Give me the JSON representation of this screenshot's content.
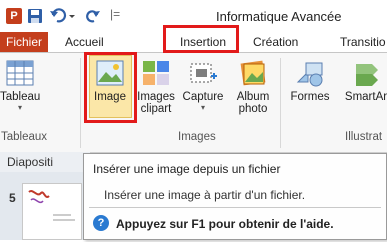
{
  "title": "Informatique Avancée",
  "quick_access": {
    "app_icon": "P",
    "separator": "|="
  },
  "tabs": {
    "file": "Fichier",
    "accueil": "Accueil",
    "insertion": "Insertion",
    "creation": "Création",
    "transitions": "Transitio"
  },
  "ribbon": {
    "tableau": "Tableau",
    "image": "Image",
    "images_line1": "Images",
    "images_line2": "clipart",
    "capture": "Capture",
    "album_line1": "Album",
    "album_line2": "photo",
    "formes": "Formes",
    "smartart": "SmartAr",
    "caret": "▾",
    "groups": {
      "tableaux": "Tableaux",
      "images": "Images",
      "illustrations": "Illustrat"
    }
  },
  "slides_panel": {
    "title": "Diapositi",
    "slide_number": "5"
  },
  "tooltip": {
    "title": "Insérer une image depuis un fichier",
    "description": "Insérer une image à partir d'un fichier.",
    "help": "Appuyez sur F1 pour obtenir de l'aide.",
    "help_icon_glyph": "?"
  },
  "colors": {
    "accent_file": "#c43e1c",
    "highlight_box": "#e21a1a",
    "image_button_bg": "#fbe7a8",
    "help_icon": "#2a7ad1"
  }
}
